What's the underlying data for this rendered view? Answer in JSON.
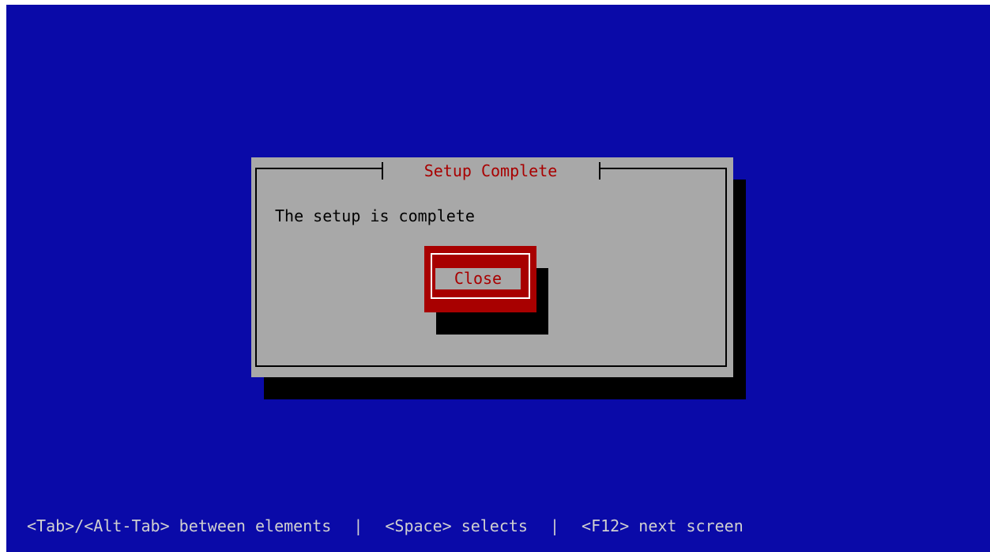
{
  "dialog": {
    "title": "Setup Complete",
    "message": "The setup is complete",
    "close_label": "Close"
  },
  "help_bar": {
    "tab_hint": "<Tab>/<Alt-Tab> between elements",
    "separator_1": "|",
    "space_hint": "<Space> selects",
    "separator_2": "|",
    "f12_hint": "<F12> next screen"
  },
  "colors": {
    "background": "#0a0aa8",
    "dialog": "#a8a8a8",
    "accent": "#a80000",
    "shadow": "#000000",
    "help_text": "#d0d0d0"
  }
}
